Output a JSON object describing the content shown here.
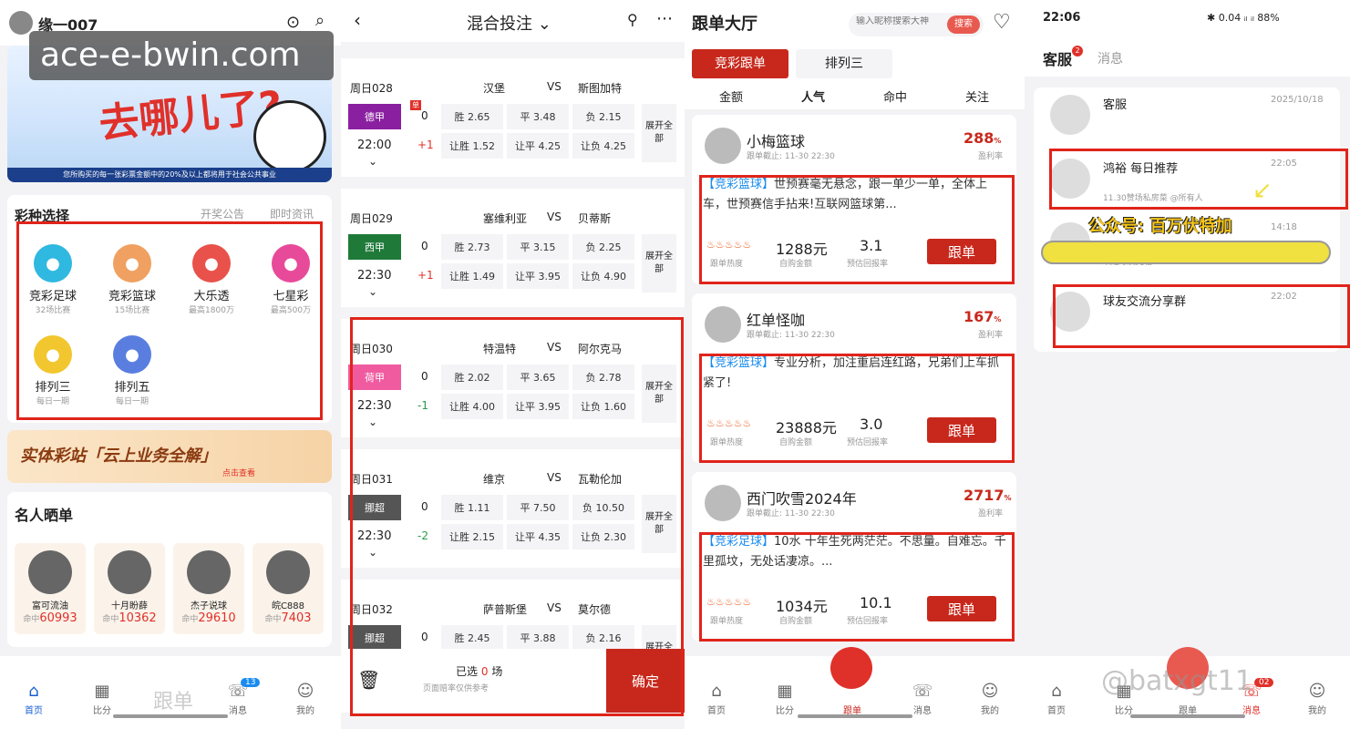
{
  "screen1": {
    "username": "缘一007",
    "watermark": "ace-e-bwin.com",
    "banner_headline": "去哪儿了?",
    "banner_note": "您所购买的每一张彩票金额中的20%及以上都将用于社会公共事业",
    "section_title": "彩种选择",
    "links": [
      "开奖公告",
      "即时资讯"
    ],
    "lotteries": [
      {
        "name": "竞彩足球",
        "sub": "32场比赛",
        "color": "#2fb8e0"
      },
      {
        "name": "竞彩篮球",
        "sub": "15场比赛",
        "color": "#f0a060"
      },
      {
        "name": "大乐透",
        "sub": "最高1800万",
        "color": "#e8524a"
      },
      {
        "name": "七星彩",
        "sub": "最高500万",
        "color": "#e84a9a"
      },
      {
        "name": "排列三",
        "sub": "每日一期",
        "color": "#f2c62e"
      },
      {
        "name": "排列五",
        "sub": "每日一期",
        "color": "#5a7ee0"
      }
    ],
    "promo_text": "实体彩站「云上业务全解」",
    "promo_link": "点击查看",
    "celeb_title": "名人晒单",
    "celebs": [
      {
        "name": "富可流油",
        "hit_label": "命中",
        "hit": "60993"
      },
      {
        "name": "十月盼薛",
        "hit_label": "命中",
        "hit": "10362"
      },
      {
        "name": "杰子说球",
        "hit_label": "命中",
        "hit": "29610"
      },
      {
        "name": "皖C888",
        "hit_label": "命中",
        "hit": "7403"
      }
    ],
    "tabs": [
      {
        "label": "首页"
      },
      {
        "label": "比分"
      },
      {
        "label": "跟单"
      },
      {
        "label": "消息"
      },
      {
        "label": "我的"
      }
    ],
    "msg_badge": "13"
  },
  "screen2": {
    "title": "混合投注",
    "matches": [
      {
        "id": "周日028",
        "home": "汉堡",
        "vs": "VS",
        "away": "斯图加特",
        "league": "德甲",
        "league_color": "#8a1fa0",
        "time": "22:00",
        "hc0": "0",
        "hc1": "+1",
        "odds": [
          "胜 2.65",
          "平 3.48",
          "负 2.15"
        ],
        "hodds": [
          "让胜 1.52",
          "让平 4.25",
          "让负 4.25"
        ],
        "flag": "单"
      },
      {
        "id": "周日029",
        "home": "塞维利亚",
        "vs": "VS",
        "away": "贝蒂斯",
        "league": "西甲",
        "league_color": "#1f7a3a",
        "time": "22:30",
        "hc0": "0",
        "hc1": "+1",
        "odds": [
          "胜 2.73",
          "平 3.15",
          "负 2.25"
        ],
        "hodds": [
          "让胜 1.49",
          "让平 3.95",
          "让负 4.90"
        ]
      },
      {
        "id": "周日030",
        "home": "特温特",
        "vs": "VS",
        "away": "阿尔克马",
        "league": "荷甲",
        "league_color": "#f05ba0",
        "time": "22:30",
        "hc0": "0",
        "hc1": "-1",
        "odds": [
          "胜 2.02",
          "平 3.65",
          "负 2.78"
        ],
        "hodds": [
          "让胜 4.00",
          "让平 3.95",
          "让负 1.60"
        ]
      },
      {
        "id": "周日031",
        "home": "维京",
        "vs": "VS",
        "away": "瓦勒伦加",
        "league": "挪超",
        "league_color": "#555555",
        "time": "22:30",
        "hc0": "0",
        "hc1": "-2",
        "odds": [
          "胜 1.11",
          "平 7.50",
          "负 10.50"
        ],
        "hodds": [
          "让胜 2.15",
          "让平 4.35",
          "让负 2.30"
        ]
      },
      {
        "id": "周日032",
        "home": "萨普斯堡",
        "vs": "VS",
        "away": "莫尔德",
        "league": "挪超",
        "league_color": "#555555",
        "time": "",
        "hc0": "0",
        "hc1": "",
        "odds": [
          "胜 2.45",
          "平 3.88",
          "负 2.16"
        ],
        "hodds": [
          "",
          "",
          ""
        ]
      }
    ],
    "expand_label": "展开全部",
    "selected_prefix": "已选",
    "selected_count": "0",
    "selected_suffix": "场",
    "odds_note": "页面赔率仅供参考",
    "confirm": "确定"
  },
  "screen3": {
    "title": "跟单大厅",
    "search_placeholder": "输入昵称搜索大神",
    "search_btn": "搜索",
    "top_tabs": [
      "竞彩跟单",
      "排列三"
    ],
    "sort_tabs": [
      "金额",
      "人气",
      "命中",
      "关注"
    ],
    "posts": [
      {
        "name": "小梅篮球",
        "deadline": "跟单截止: 11-30 22:30",
        "rate": "288",
        "rate_unit": "%",
        "rate_label": "盈利率",
        "tag": "【竞彩篮球】",
        "text": "世预赛毫无悬念，跟一单少一单，全体上车，世预赛信手拈来!互联网篮球第...",
        "amount": "1288元",
        "ret": "3.1",
        "heat_label": "跟单热度",
        "amount_label": "自购金额",
        "ret_label": "预估回报率",
        "follow": "跟单"
      },
      {
        "name": "红单怪咖",
        "deadline": "跟单截止: 11-30 22:30",
        "rate": "167",
        "rate_unit": "%",
        "rate_label": "盈利率",
        "tag": "【竞彩篮球】",
        "text": "专业分析，加注重启连红路，兄弟们上车抓紧了!",
        "amount": "23888元",
        "ret": "3.0",
        "heat_label": "跟单热度",
        "amount_label": "自购金额",
        "ret_label": "预估回报率",
        "follow": "跟单"
      },
      {
        "name": "西门吹雪2024年",
        "deadline": "跟单截止: 11-30 22:30",
        "rate": "2717",
        "rate_unit": "%",
        "rate_label": "盈利率",
        "tag": "【竞彩足球】",
        "text": "10水 十年生死两茫茫。不思量。自难忘。千里孤坟，无处话凄凉。...",
        "amount": "1034元",
        "ret": "10.1",
        "heat_label": "跟单热度",
        "amount_label": "自购金额",
        "ret_label": "预估回报率",
        "follow": "跟单"
      }
    ],
    "tabs": [
      {
        "label": "首页"
      },
      {
        "label": "比分"
      },
      {
        "label": "跟单"
      },
      {
        "label": "消息"
      },
      {
        "label": "我的"
      }
    ]
  },
  "screen4": {
    "status_time": "22:06",
    "status_icons": "✱ 0.04 ᵢₗ ᵢₗ 88%",
    "tab_service": "客服",
    "tab_badge": "2",
    "tab_messages": "消息",
    "chats": [
      {
        "name": "客服",
        "time": "2025/10/18",
        "preview": ""
      },
      {
        "name": "鸿裕 每日推荐",
        "time": "22:05",
        "preview": "11.30赞场私房菜 @所有人"
      },
      {
        "name": "",
        "time": "14:18",
        "preview": "欢迎球友光临..."
      },
      {
        "name": "球友交流分享群",
        "time": "22:02",
        "preview": ""
      }
    ],
    "overlay_text": "公众号: 百万伏特加",
    "watermark": "@batxgt11",
    "tabs": [
      {
        "label": "首页"
      },
      {
        "label": "比分"
      },
      {
        "label": "跟单"
      },
      {
        "label": "消息"
      },
      {
        "label": "我的"
      }
    ],
    "msg_badge": "02"
  }
}
